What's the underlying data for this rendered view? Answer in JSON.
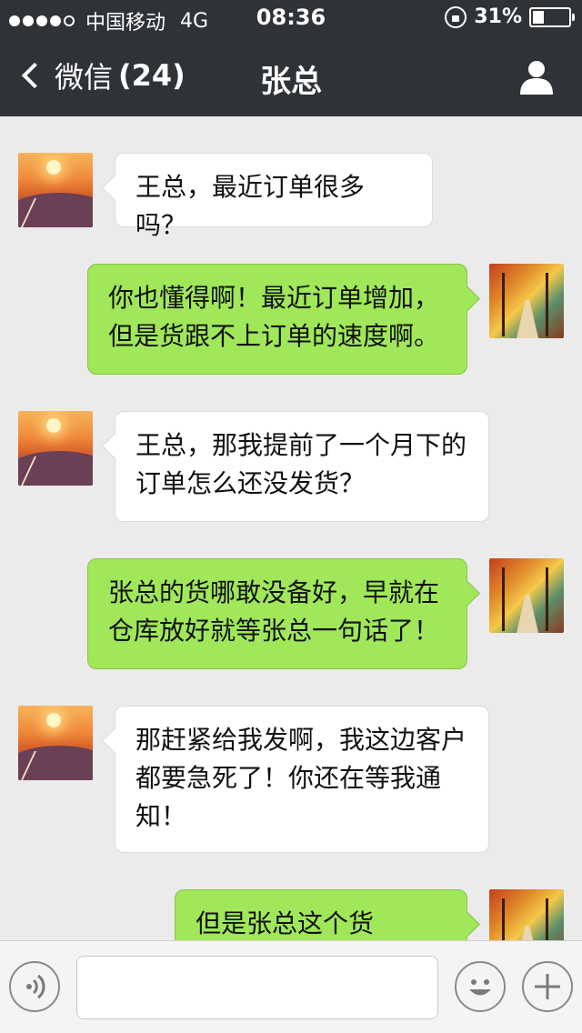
{
  "status_bar": {
    "carrier": "中国移动",
    "network": "4G",
    "time": "08:36",
    "battery_percent": "31%",
    "battery_level": 0.31,
    "signal_dots_filled": 4,
    "signal_dots_total": 5
  },
  "nav": {
    "back_label": "微信",
    "unread_count": "(24)",
    "title": "张总",
    "profile_icon": "person-icon"
  },
  "messages": [
    {
      "side": "in",
      "text_lines": [
        "王总，最近订单很多吗？"
      ]
    },
    {
      "side": "out",
      "text_lines": [
        "你也懂得啊！最近订单增加，",
        "但是货跟不上订单的速度啊。"
      ]
    },
    {
      "side": "in",
      "text_lines": [
        "王总，那我提前了一个月下的",
        "订单怎么还没发货？"
      ]
    },
    {
      "side": "out",
      "text_lines": [
        "张总的货哪敢没备好，早就在",
        "仓库放好就等张总一句话了！"
      ]
    },
    {
      "side": "in",
      "text_lines": [
        "那赶紧给我发啊，我这边客户",
        "都要急死了！你还在等我通",
        "知！"
      ]
    },
    {
      "side": "out",
      "text_lines": [
        "但是张总这个货款……"
      ]
    }
  ],
  "input_bar": {
    "placeholder": "",
    "voice_icon": "voice-icon",
    "emoji_icon": "emoji-icon",
    "plus_icon": "plus-icon"
  },
  "colors": {
    "topbar": "#2f3236",
    "outgoing_bubble": "#a0e75a",
    "incoming_bubble": "#ffffff",
    "chat_background": "#ebebeb"
  }
}
